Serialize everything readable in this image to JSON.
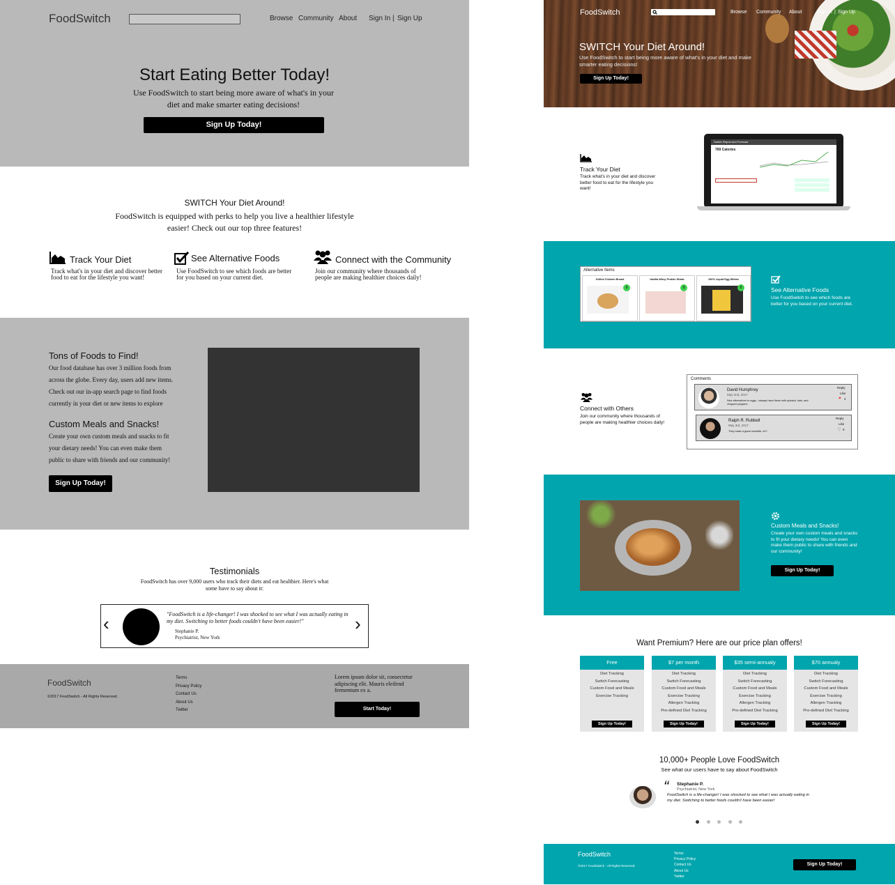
{
  "wireframe": {
    "logo": "FoodSwitch",
    "nav": {
      "browse": "Browse",
      "community": "Community",
      "about": "About",
      "sign_in": "Sign In",
      "sep": "|",
      "sign_up": "Sign Up"
    },
    "hero": {
      "title": "Start Eating Better Today!",
      "subtitle": "Use FoodSwitch to start being more aware of what's in your diet and make smarter eating decisions!",
      "cta": "Sign Up Today!"
    },
    "switch": {
      "title": "SWITCH Your Diet Around!",
      "subtitle": "FoodSwitch is equipped with perks to help you live a healthier lifestyle easier! Check out our top three features!"
    },
    "features": [
      {
        "title": "Track Your Diet",
        "desc": "Track what's in your diet and discover better food to eat for the lifestyle you want!",
        "icon": "chart-area-icon"
      },
      {
        "title": "See Alternative Foods",
        "desc": "Use FoodSwitch to see which foods are better for you based on your current diet.",
        "icon": "check-square-icon"
      },
      {
        "title": "Connect with the Community",
        "desc": "Join our community where thousands of people are making healthier choices daily!",
        "icon": "users-icon"
      }
    ],
    "info": {
      "foods_title": "Tons of Foods to Find!",
      "foods_body": "Our food database has over 3 million foods from across the globe. Every day, users add new items. Check out our in-app search page to find foods currently in your diet or new items to explore",
      "meals_title": "Custom Meals and Snacks!",
      "meals_body": "Create your own custom meals and snacks to fit your dietary needs! You can even make them public to share with friends and our community!",
      "cta": "Sign Up Today!"
    },
    "testimonials": {
      "title": "Testimonials",
      "subtitle": "FoodSwitch has over 9,000 users who track their diets and eat healthier. Here's what some have to say about it:",
      "quote": "\"FoodSwitch is a life-changer! I was shocked to see what I was actually eating in my diet. Switching to better foods couldn't have been easier!\"",
      "name": "Stephanie P.",
      "role": "Psychiatrist, New York",
      "prev": "‹",
      "next": "›"
    },
    "footer": {
      "logo": "FoodSwitch",
      "copyright": "©2017 FoodSwitch - All Rights Reserved.",
      "links": [
        "Terms",
        "Privacy Policy",
        "Contact Us",
        "About Us",
        "Twitter"
      ],
      "lorem": "Lorem ipsum dolor sit, consectetur adipiscing elit. Mauris eleifend fermentum ex a.",
      "cta": "Start Today!"
    }
  },
  "mockup": {
    "logo": "FoodSwitch",
    "nav": {
      "browse": "Browse",
      "community": "Community",
      "about": "About",
      "sign_in": "Sign In",
      "sep": "|",
      "sign_up": "Sign Up"
    },
    "hero": {
      "title": "SWITCH Your Diet Around!",
      "subtitle": "Use FoodSwitch to start being more aware of what's in your diet and make smarter eating decisions!",
      "cta": "Sign Up Today!"
    },
    "track": {
      "title": "Track Your Diet",
      "desc": "Track what's in your diet and discover better food to eat for the lifestyle you want!",
      "laptop_header": "Switch Report and Forecast",
      "calories": "769 Calories"
    },
    "alternatives": {
      "panel_title": "Alternative Items",
      "items": [
        {
          "name": "Grilled Chicken Breast",
          "score": "9"
        },
        {
          "name": "Vanilla Whey Protein Shake",
          "score": "8"
        },
        {
          "name": "100% Liquid Egg Whites",
          "score": "8"
        }
      ],
      "title": "See Alternative Foods",
      "desc": "Use FoodSwitch to see which foods are better for you based on your current diet."
    },
    "community": {
      "title": "Connect with Others",
      "desc": "Join our community where thousands of people are making healthier choices daily!",
      "comments_title": "Comments",
      "comments": [
        {
          "name": "David Humphrey",
          "date": "May 2nd, 2017",
          "text": "Nice alternatives to eggs. I always have these with spinach, kale, and chopped peppers.",
          "reply": "Reply",
          "like": "Like",
          "likes": "2"
        },
        {
          "name": "Ralph R. Rubbell",
          "date": "May 3rd, 2017",
          "text": "They make a great omelette, eh?",
          "reply": "Reply",
          "like": "Like",
          "likes": "0"
        }
      ]
    },
    "custom": {
      "title": "Custom Meals and Snacks!",
      "desc": "Create your own custom meals and snacks to fit your dietary needs! You can even make them public to share with friends and our community!",
      "cta": "Sign Up Today!"
    },
    "pricing": {
      "title": "Want Premium? Here are our price plan offers!",
      "plans": [
        {
          "name": "Free",
          "features": [
            "Diet Tracking",
            "Switch Forecasting",
            "Custom Food and Meals",
            "Exercise Tracking"
          ],
          "cta": "Sign Up Today!"
        },
        {
          "name": "$7 per month",
          "features": [
            "Diet Tracking",
            "Switch Forecasting",
            "Custom Food and Meals",
            "Exercise Tracking",
            "Allergen Tracking",
            "Pre-defined Diet Tracking"
          ],
          "cta": "Sign Up Today!"
        },
        {
          "name": "$35 semi-annualy",
          "features": [
            "Diet Tracking",
            "Switch Forecasting",
            "Custom Food and Meals",
            "Exercise Tracking",
            "Allergen Tracking",
            "Pre-defined Diet Tracking"
          ],
          "cta": "Sign Up Today!"
        },
        {
          "name": "$70 annualy",
          "features": [
            "Diet Tracking",
            "Switch Forecasting",
            "Custom Food and Meals",
            "Exercise Tracking",
            "Allergen Tracking",
            "Pre-defined Diet Tracking"
          ],
          "cta": "Sign Up Today!"
        }
      ]
    },
    "love": {
      "title": "10,000+ People Love FoodSwitch",
      "subtitle": "See what our users have to say about FoodSwitch",
      "name": "Stephanie P.",
      "role": "Psychiatrist, New York",
      "quote": "FoodSwitch is a life-changer! I was shocked to see what I was actually eating in my diet. Switching to better foods couldn't have been easier!"
    },
    "footer": {
      "logo": "FoodSwitch",
      "copyright": "©2017 FoodSwitch - All Rights Reserved.",
      "links": [
        "Terms",
        "Privacy Policy",
        "Contact Us",
        "About Us",
        "Twitter"
      ],
      "cta": "Sign Up Today!"
    }
  },
  "colors": {
    "teal": "#00a5ad",
    "wire_gray": "#b9b9b9",
    "black": "#000000"
  }
}
